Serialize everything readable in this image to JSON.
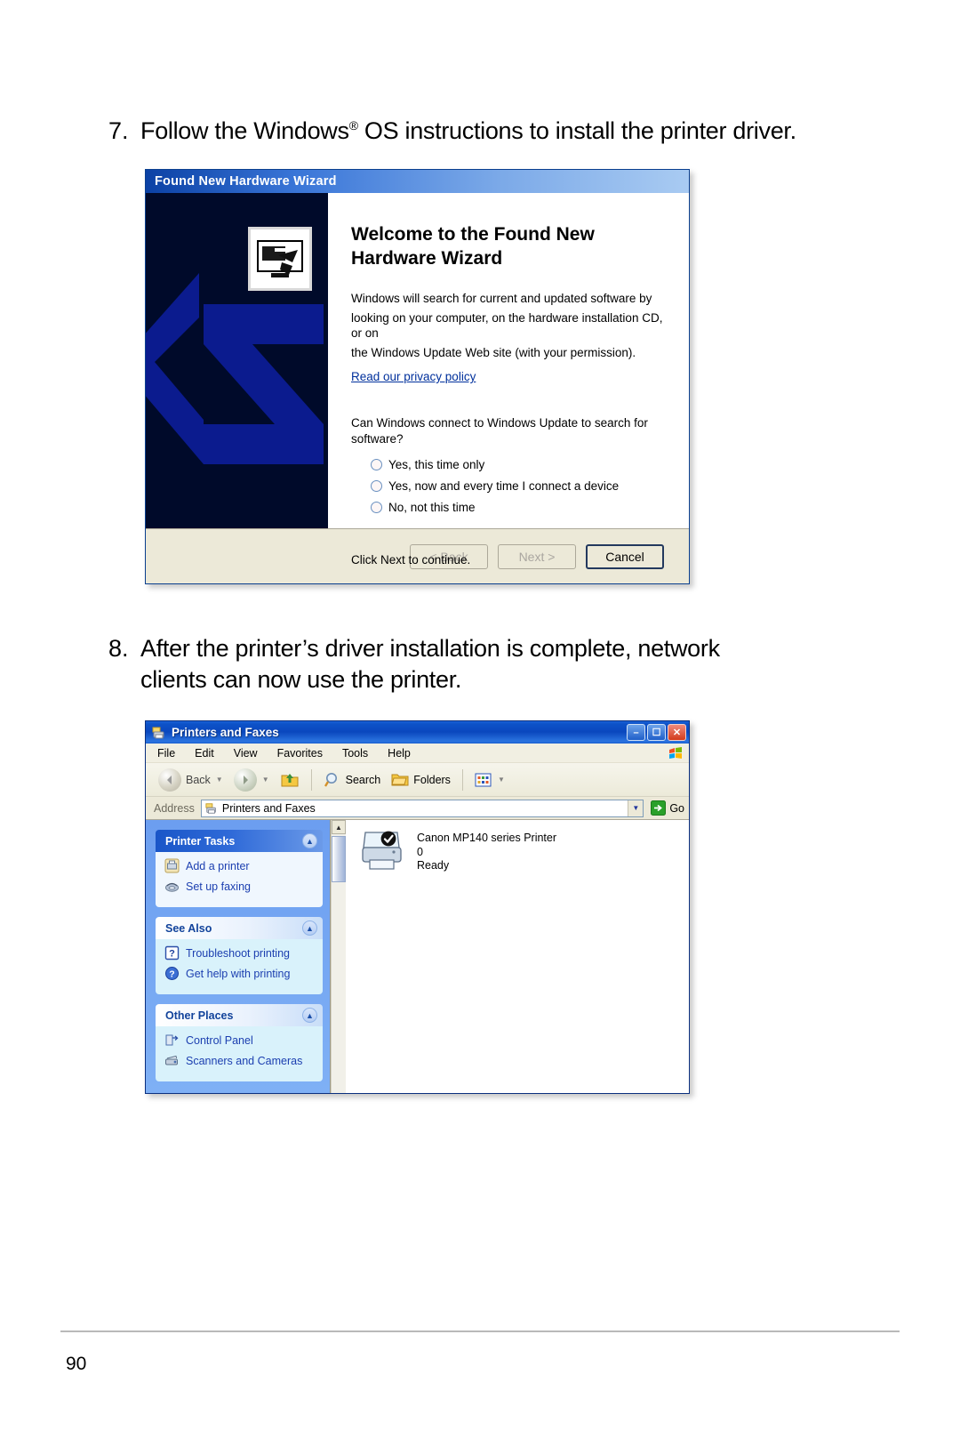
{
  "document": {
    "page_number": "90"
  },
  "steps": [
    {
      "number": "7.",
      "text_before": "Follow the Windows",
      "superscript": "®",
      "text_after": " OS instructions to install the printer driver."
    },
    {
      "number": "8.",
      "line1": "After the printer’s driver installation is complete, network",
      "line2": "clients can now use the printer."
    }
  ],
  "wizard": {
    "title": "Found New Hardware Wizard",
    "heading_line1": "Welcome to the Found New",
    "heading_line2": "Hardware Wizard",
    "paragraph_line1": "Windows will search for current and updated software by",
    "paragraph_line2": "looking on your computer, on the hardware installation CD, or on",
    "paragraph_line3": "the Windows Update Web site (with your permission).",
    "privacy_link": "Read our privacy policy",
    "question_line1": "Can Windows connect to Windows Update to search for",
    "question_line2": "software?",
    "options": [
      {
        "label": "Yes, this time only",
        "selected": false
      },
      {
        "label": "Yes, now and every time I connect a device",
        "selected": false
      },
      {
        "label": "No, not this time",
        "selected": false
      }
    ],
    "click_next": "Click Next to continue.",
    "buttons": {
      "back": "< Back",
      "next": "Next >",
      "cancel": "Cancel"
    }
  },
  "explorer": {
    "title": "Printers and Faxes",
    "window_buttons": {
      "minimize": "–",
      "maximize": "☐",
      "close": "✕"
    },
    "menu": [
      {
        "label": "File",
        "accel": "F"
      },
      {
        "label": "Edit",
        "accel": "E"
      },
      {
        "label": "View",
        "accel": "V"
      },
      {
        "label": "Favorites",
        "accel": "a"
      },
      {
        "label": "Tools",
        "accel": "T"
      },
      {
        "label": "Help",
        "accel": "H"
      }
    ],
    "toolbar": {
      "back": "Back",
      "forward": "",
      "up": "",
      "search": "Search",
      "folders": "Folders",
      "views": ""
    },
    "address": {
      "label": "Address",
      "value": "Printers and Faxes",
      "go": "Go"
    },
    "sidebar": [
      {
        "title": "Printer Tasks",
        "style": "blue",
        "items": [
          {
            "label": "Add a printer",
            "icon": "add-printer-icon"
          },
          {
            "label": "Set up faxing",
            "icon": "fax-icon"
          }
        ]
      },
      {
        "title": "See Also",
        "style": "pale",
        "items": [
          {
            "label": "Troubleshoot printing",
            "icon": "question-box-icon"
          },
          {
            "label": "Get help with printing",
            "icon": "help-circle-icon"
          }
        ]
      },
      {
        "title": "Other Places",
        "style": "pale",
        "items": [
          {
            "label": "Control Panel",
            "icon": "control-panel-icon"
          },
          {
            "label": "Scanners and Cameras",
            "icon": "scanner-icon"
          }
        ]
      }
    ],
    "printers": [
      {
        "name": "Canon MP140 series Printer",
        "queue_count": "0",
        "status": "Ready",
        "is_default": true
      }
    ]
  },
  "colors": {
    "title_blue": "#0a47be",
    "sidebar_blue": "#6c9ef0",
    "link_blue": "#1c3fb0",
    "dialog_face": "#ece9d8"
  }
}
